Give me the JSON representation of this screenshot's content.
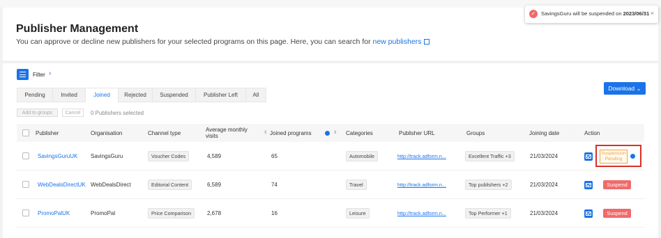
{
  "header": {
    "title": "Publisher Management",
    "description": "You can approve or decline new publishers for your selected programs on this page. Here, you can search for",
    "description_link": "new publishers"
  },
  "toast": {
    "message_prefix": "SavingsGuru will be suspended on",
    "message_date": "2023/06/31",
    "close": "×",
    "icon": "check-icon"
  },
  "filter": {
    "label": "Filter",
    "chevron": "›"
  },
  "tabs": [
    {
      "label": "Pending",
      "active": false
    },
    {
      "label": "Invited",
      "active": false
    },
    {
      "label": "Joined",
      "active": true
    },
    {
      "label": "Rejected",
      "active": false
    },
    {
      "label": "Suspended",
      "active": false
    },
    {
      "label": "Publisher Left",
      "active": false
    },
    {
      "label": "All",
      "active": false
    }
  ],
  "download": {
    "label": "Download",
    "chevron": "⌄"
  },
  "bulk": {
    "add_to_groups": "Add to groups",
    "cancel": "Cancel",
    "selected": "0 Publishers selected"
  },
  "table": {
    "columns": {
      "publisher": "Publisher",
      "organisation": "Organisation",
      "channel_type": "Channel type",
      "avg_visits": "Average monthly visits",
      "joined_programs": "Joined programs",
      "categories": "Categories",
      "publisher_url": "Publisher URL",
      "groups": "Groups",
      "joining_date": "Joining date",
      "action": "Action"
    },
    "sort_glyph": "⇕",
    "rows": [
      {
        "publisher": "SavingsGuruUK",
        "organisation": "SavingsGuru",
        "channel_type": "Voucher Codes",
        "avg_visits": "4,589",
        "joined_programs": "65",
        "category": "Automobile",
        "url": "http://track.adform.n...",
        "groups": "Excellent Traffic +3",
        "joining_date": "21/03/2024",
        "action_line1": "Suspension",
        "action_line2": "Pending"
      },
      {
        "publisher": "WebDealsDirectUK",
        "organisation": "WebDealsDirect",
        "channel_type": "Editorial Content",
        "avg_visits": "6,589",
        "joined_programs": "74",
        "category": "Travel",
        "url": "http://track.adform.n...",
        "groups": "Top publishers +2",
        "joining_date": "21/03/2024",
        "action": "Suspend"
      },
      {
        "publisher": "PromoPalUK",
        "organisation": "PromoPal",
        "channel_type": "Price Comparison",
        "avg_visits": "2,678",
        "joined_programs": "16",
        "category": "Leisure",
        "url": "http://track.adform.n...",
        "groups": "Top Performer +1",
        "joining_date": "21/03/2024",
        "action": "Suspend"
      }
    ]
  },
  "colors": {
    "accent": "#1a73e8",
    "danger": "#f06a6a",
    "warning": "#f2a33a",
    "highlight": "#d93025"
  }
}
